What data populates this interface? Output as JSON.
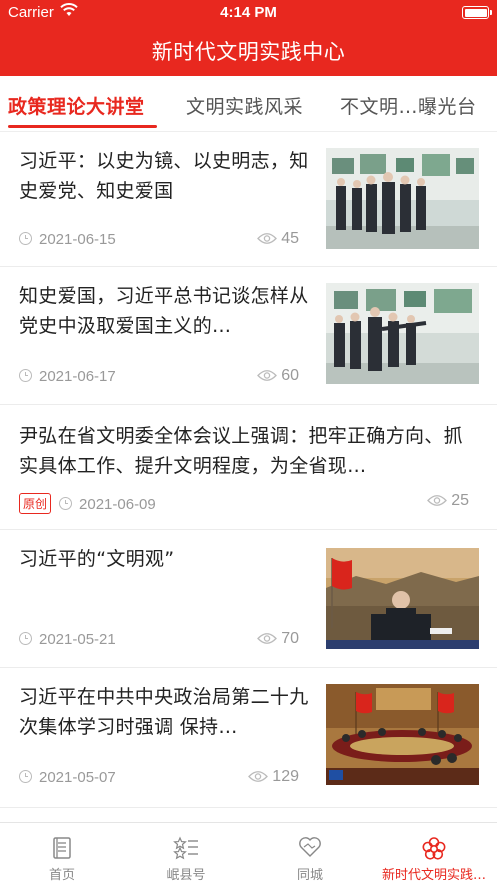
{
  "status_bar": {
    "carrier": "Carrier",
    "time": "4:14 PM"
  },
  "header": {
    "title": "新时代文明实践中心"
  },
  "tabs": [
    {
      "label": "政策理论大讲堂",
      "active": true
    },
    {
      "label": "文明实践风采",
      "active": false
    },
    {
      "label": "不文明…曝光台",
      "active": false
    }
  ],
  "news": [
    {
      "title": "习近平：以史为镜、以史明志，知史爱党、知史爱国",
      "date": "2021-06-15",
      "views": "45",
      "badge": "",
      "has_image": true,
      "image": "officials-visiting-exhibition"
    },
    {
      "title": "知史爱国，习近平总书记谈怎样从党史中汲取爱国主义的…",
      "date": "2021-06-17",
      "views": "60",
      "badge": "",
      "has_image": true,
      "image": "officials-visiting-exhibition"
    },
    {
      "title": "尹弘在省文明委全体会议上强调：把牢正确方向、抓实具体工作、提升文明程度，为全省现…",
      "date": "2021-06-09",
      "views": "25",
      "badge": "原创",
      "has_image": false
    },
    {
      "title": "习近平的“文明观”",
      "date": "2021-05-21",
      "views": "70",
      "badge": "",
      "has_image": true,
      "image": "speaker-with-flag"
    },
    {
      "title": "习近平在中共中央政治局第二十九次集体学习时强调 保持…",
      "date": "2021-05-07",
      "views": "129",
      "badge": "",
      "has_image": true,
      "image": "meeting-hall"
    }
  ],
  "bottom_nav": [
    {
      "label": "首页",
      "icon": "home-book-icon",
      "active": false
    },
    {
      "label": "岷县号",
      "icon": "star-list-icon",
      "active": false
    },
    {
      "label": "同城",
      "icon": "heart-handshake-icon",
      "active": false
    },
    {
      "label": "新时代文明实践…",
      "icon": "flower-icon",
      "active": true
    }
  ],
  "colors": {
    "accent": "#e8281f",
    "meta_gray": "#999999"
  }
}
